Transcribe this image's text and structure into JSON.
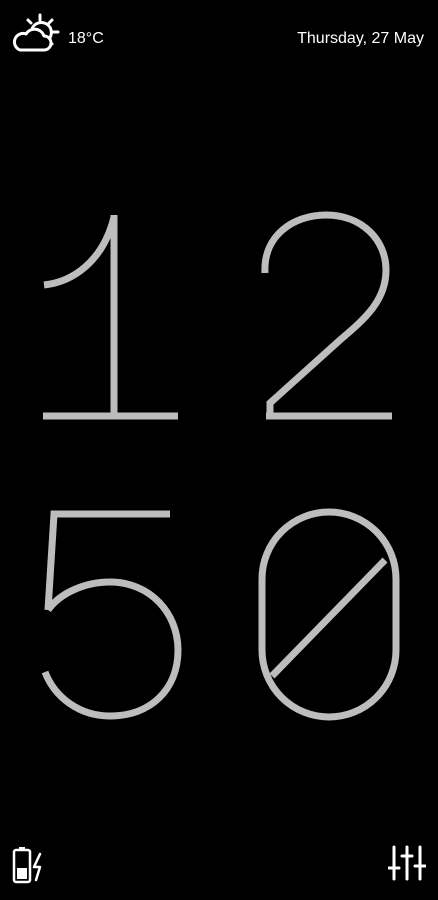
{
  "status_bar": {
    "weather_icon": "partly-cloudy-sun-icon",
    "temperature": "18°C",
    "date": "Thursday, 27 May"
  },
  "clock": {
    "hours": [
      "1",
      "2"
    ],
    "minutes": [
      "5",
      "0"
    ],
    "digit_color": "#bdbdbd"
  },
  "footer": {
    "battery_icon": "battery-charging-icon",
    "settings_icon": "sliders-icon"
  },
  "colors": {
    "background": "#000000",
    "text": "#ffffff",
    "digit": "#bdbdbd"
  }
}
